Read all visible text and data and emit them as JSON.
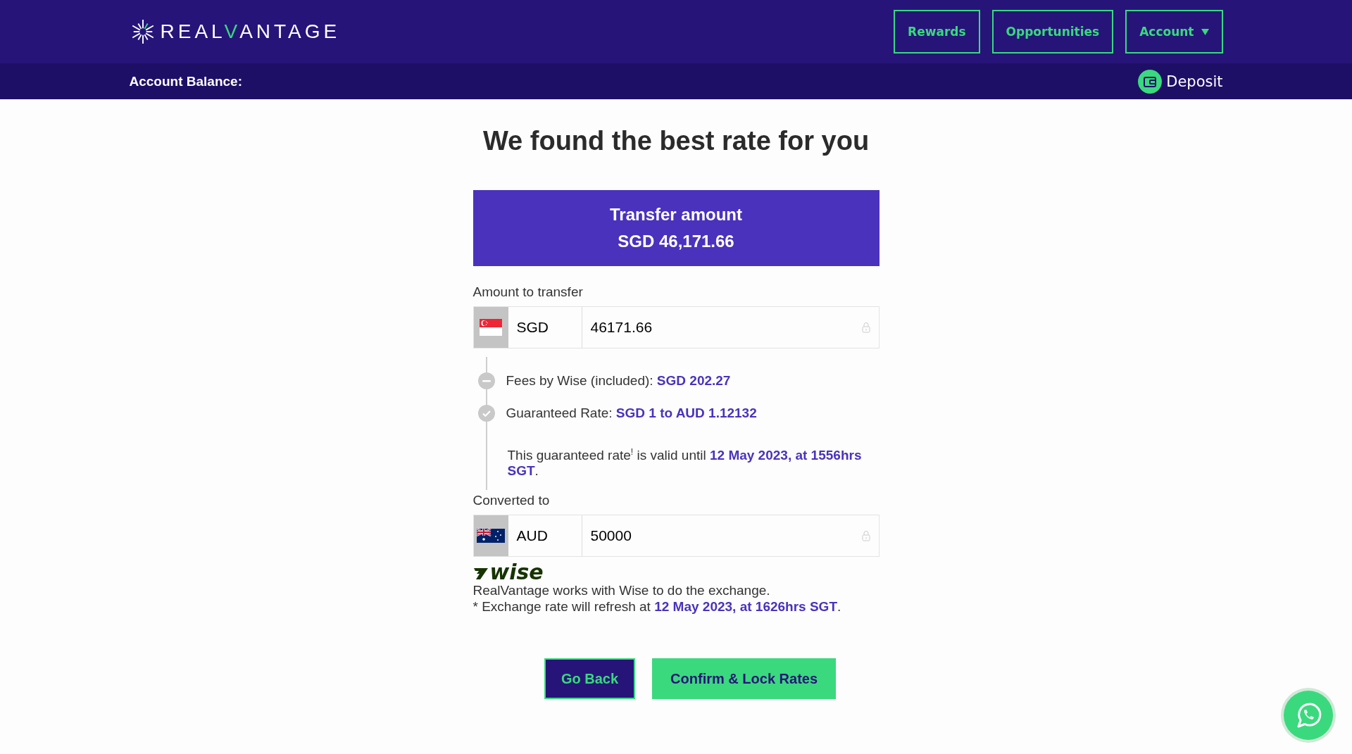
{
  "header": {
    "logo": {
      "before": "REAL",
      "accent": "V",
      "after": "ANTAGE"
    },
    "nav": [
      {
        "label": "Rewards",
        "dropdown": false
      },
      {
        "label": "Opportunities",
        "dropdown": false
      },
      {
        "label": "Account",
        "dropdown": true
      }
    ]
  },
  "balance_bar": {
    "label": "Account Balance:",
    "deposit": "Deposit"
  },
  "title": "We found the best rate for you",
  "summary": {
    "label": "Transfer amount",
    "amount": "SGD 46,171.66"
  },
  "from": {
    "label": "Amount to transfer",
    "currency": "SGD",
    "kind": "sg",
    "value": "46171.66",
    "locked": true
  },
  "details": [
    {
      "kind": "fee",
      "text": "Fees by Wise (included): **SGD 202.27**"
    },
    {
      "kind": "rate",
      "text": "Guaranteed Rate: **SGD 1 to AUD 1.12132**"
    },
    {
      "kind": "note",
      "text": "This guaranteed rate$^{!}$ is valid until **12 May 2023, at 1556hrs SGT**."
    }
  ],
  "to": {
    "label": "Converted to",
    "currency": "AUD",
    "kind": "au",
    "value": "50000",
    "locked": true
  },
  "partner": {
    "logo": "wise",
    "lines": [
      "RealVantage works with Wise to do the exchange.",
      "* Exchange rate will refresh at **12 May 2023, at 1626hrs SGT**."
    ]
  },
  "buttons": [
    {
      "label": "Go Back",
      "kind": "secondary"
    },
    {
      "label": "Confirm & Lock Rates",
      "kind": "primary"
    }
  ]
}
